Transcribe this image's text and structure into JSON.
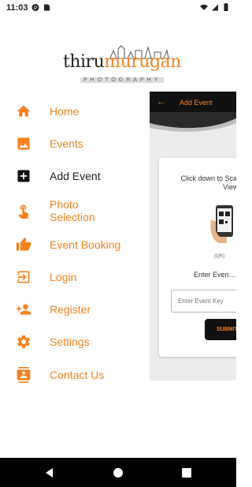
{
  "status_bar": {
    "time": "11:03"
  },
  "logo": {
    "part1": "thiru",
    "part2": "murugan",
    "subtitle": "PHOTOGRAPHY"
  },
  "menu": {
    "items": [
      {
        "label": "Home",
        "icon": "home-icon"
      },
      {
        "label": "Events",
        "icon": "image-icon"
      },
      {
        "label": "Add Event",
        "icon": "add-box-icon",
        "active": true
      },
      {
        "label": "Photo Selection",
        "icon": "touch-icon"
      },
      {
        "label": "Event Booking",
        "icon": "thumbs-up-icon"
      },
      {
        "label": "Login",
        "icon": "login-icon"
      },
      {
        "label": "Register",
        "icon": "person-add-icon"
      },
      {
        "label": "Settings",
        "icon": "gear-icon"
      },
      {
        "label": "Contact Us",
        "icon": "contact-card-icon"
      }
    ]
  },
  "event_screen": {
    "title": "Add Event",
    "instruction": "Click down to Sca… to View E…",
    "qr_caption": "(QR)",
    "enter_label": "Enter Even…",
    "input_placeholder": "Enter Event Key",
    "submit_label": "SUBMIT"
  },
  "colors": {
    "accent": "#f5821f",
    "dark": "#111111"
  }
}
